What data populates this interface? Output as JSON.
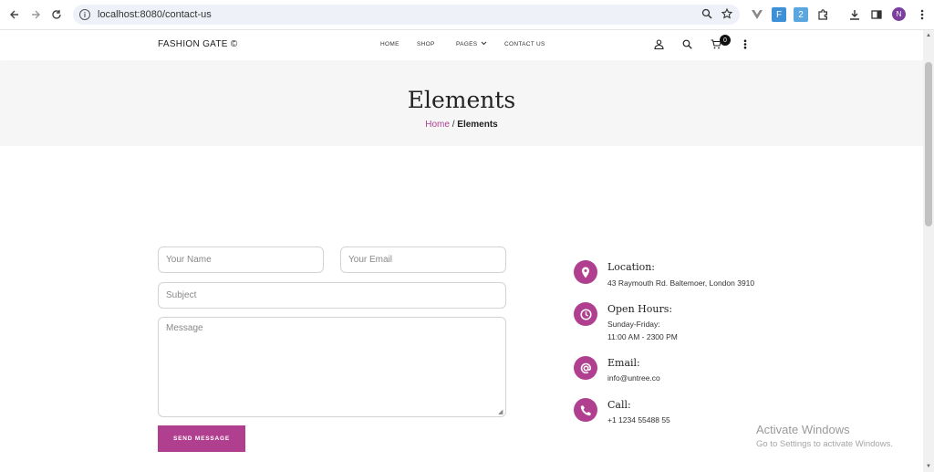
{
  "browser": {
    "url": "localhost:8080/contact-us",
    "profile_initial": "N",
    "icons": [
      "back-icon",
      "forward-icon",
      "reload-icon",
      "info-icon",
      "zoom-icon",
      "star-icon",
      "extension-icons",
      "download-icon",
      "sidepanel-icon",
      "kebab-menu-icon"
    ]
  },
  "header": {
    "brand": "FASHION GATE ©",
    "nav": [
      "HOME",
      "SHOP",
      "PAGES",
      "CONTACT US"
    ],
    "cart_count": "0"
  },
  "hero": {
    "title": "Elements",
    "breadcrumb_home": "Home",
    "breadcrumb_sep": " / ",
    "breadcrumb_current": "Elements"
  },
  "form": {
    "name_placeholder": "Your Name",
    "email_placeholder": "Your Email",
    "subject_placeholder": "Subject",
    "message_placeholder": "Message",
    "submit_label": "SEND MESSAGE"
  },
  "contact": {
    "location_title": "Location:",
    "location_text": "43 Raymouth Rd. Baltemoer, London 3910",
    "hours_title": "Open Hours:",
    "hours_line1": "Sunday-Friday:",
    "hours_line2": "11:00 AM - 2300 PM",
    "email_title": "Email:",
    "email_text": "info@untree.co",
    "call_title": "Call:",
    "call_text": "+1 1234 55488 55"
  },
  "watermark": {
    "line1": "Activate Windows",
    "line2": "Go to Settings to activate Windows."
  },
  "colors": {
    "accent": "#b0408f",
    "hero_bg": "#f6f6f7"
  }
}
